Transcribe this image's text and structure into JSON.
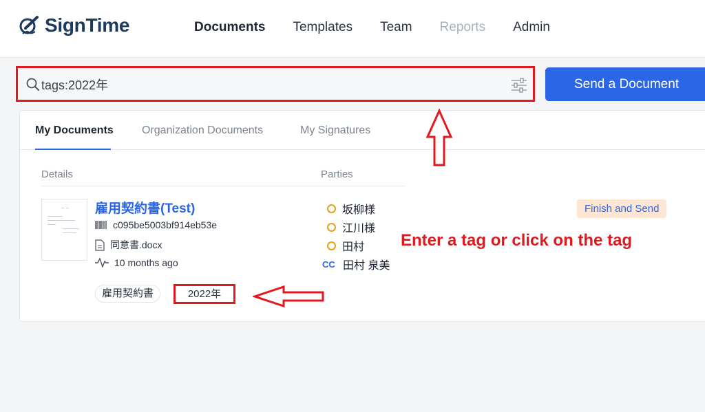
{
  "header": {
    "brand": "SignTime",
    "nav": [
      "Documents",
      "Templates",
      "Team",
      "Reports",
      "Admin"
    ],
    "active_nav": "Documents",
    "disabled_nav": "Reports"
  },
  "search": {
    "value": "tags:2022年",
    "icon": "search-icon",
    "filter_icon": "sliders-icon"
  },
  "actions": {
    "send_label": "Send a Document"
  },
  "tabs": [
    "My Documents",
    "Organization Documents",
    "My Signatures"
  ],
  "active_tab": "My Documents",
  "table": {
    "headers": {
      "details": "Details",
      "parties": "Parties"
    },
    "document": {
      "title": "雇用契約書(Test)",
      "id": "c095be5003bf914eb53e",
      "file": "同意書.docx",
      "updated": "10 months ago",
      "tags": [
        "雇用契約書",
        "2022年"
      ],
      "parties": [
        {
          "type": "signer",
          "name": "坂柳様"
        },
        {
          "type": "signer",
          "name": "江川様"
        },
        {
          "type": "signer",
          "name": "田村"
        },
        {
          "type": "cc",
          "label": "CC",
          "name": "田村 泉美"
        }
      ],
      "status": "Finish and Send"
    }
  },
  "annotation": {
    "text": "Enter a tag or click on the tag",
    "color": "#e0191f"
  },
  "colors": {
    "accent": "#2a66e6",
    "highlight": "#e0191f",
    "pending": "#e3a21a",
    "badge_bg": "#fde7d4"
  }
}
